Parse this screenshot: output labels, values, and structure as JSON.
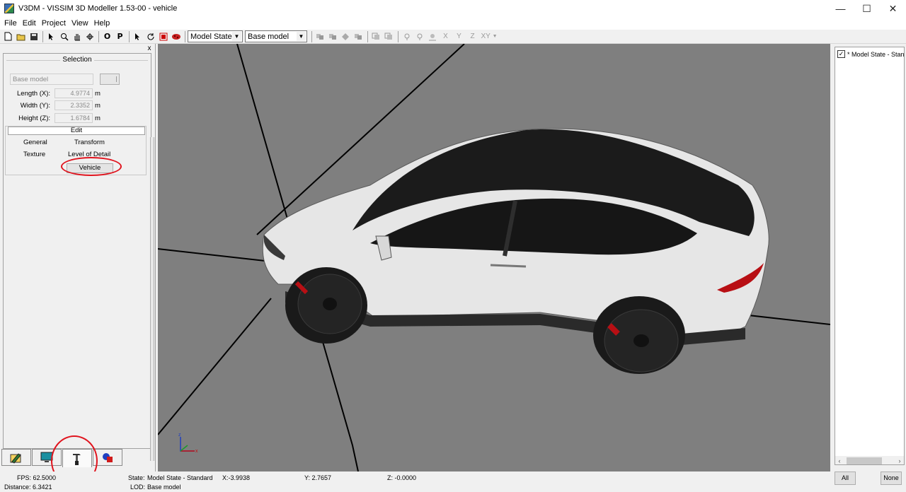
{
  "window": {
    "title": "V3DM - VISSIM 3D Modeller 1.53-00 - vehicle",
    "minimize": "—",
    "maximize": "☐",
    "close": "✕"
  },
  "menu": [
    "File",
    "Edit",
    "Project",
    "View",
    "Help"
  ],
  "toolbar": {
    "o_label": "O",
    "p_label": "P",
    "state_select": "Model State -",
    "lod_select": "Base model",
    "axis_x": "X",
    "axis_y": "Y",
    "axis_z": "Z",
    "axis_xy": "XY"
  },
  "left_panel": {
    "close": "x",
    "selection_title": "Selection",
    "model_value": "Base model",
    "length_label": "Length (X):",
    "length_value": "4.9774",
    "width_label": "Width (Y):",
    "width_value": "2.3352",
    "height_label": "Height (Z):",
    "height_value": "1.6784",
    "unit": "m",
    "edit_title": "Edit",
    "general": "General",
    "transform": "Transform",
    "texture": "Texture",
    "lod": "Level of Detail",
    "vehicle": "Vehicle"
  },
  "right_panel": {
    "tree_item": "* Model State - Stan",
    "all_button": "All",
    "none_button": "None"
  },
  "status": {
    "fps": "FPS: 62.5000",
    "distance": "Distance: 6.3421",
    "state_label": "State:",
    "state_value": "Model State - Standard",
    "lod_label": "LOD:",
    "lod_value": "Base model",
    "x": "X:-3.9938",
    "y": "Y: 2.7657",
    "z": "Z: -0.0000"
  },
  "colors": {
    "viewport_bg": "#7f7f7f",
    "highlight": "#e0141e",
    "car_body": "#e8e8e8",
    "glass": "#1a1a1a"
  }
}
